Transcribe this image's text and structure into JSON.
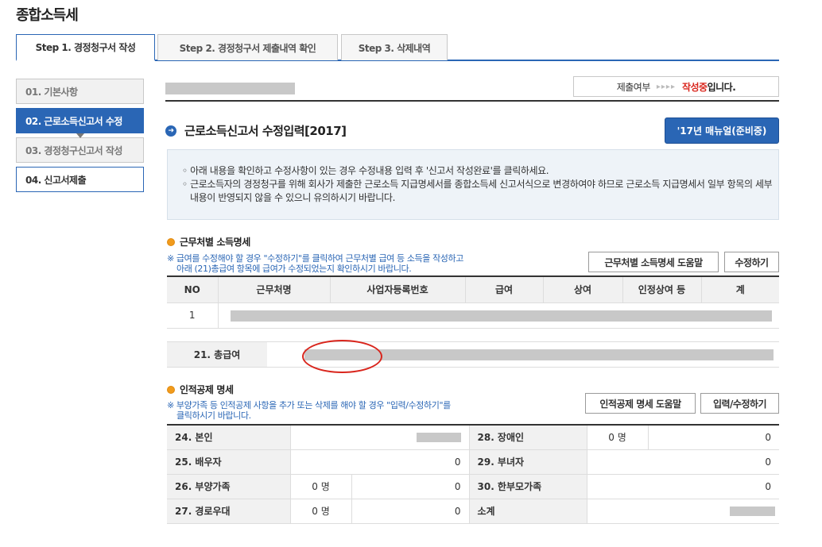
{
  "page": {
    "title": "종합소득세"
  },
  "tabs": [
    {
      "label": "Step 1. 경정청구서 작성",
      "active": true
    },
    {
      "label": "Step 2. 경정청구서 제출내역 확인",
      "active": false
    },
    {
      "label": "Step 3. 삭제내역",
      "active": false
    }
  ],
  "steps": [
    {
      "label": "01. 기본사항"
    },
    {
      "label": "02. 근로소득신고서 수정"
    },
    {
      "label": "03. 경정청구신고서 작성"
    },
    {
      "label": "04. 신고서제출"
    }
  ],
  "status": {
    "label": "제출여부",
    "arrow": "▸▸▸▸",
    "value_red": "작성중",
    "value_suffix": "입니다."
  },
  "section": {
    "icon": "arrow-right-circle-icon",
    "title": "근로소득신고서 수정입력[2017]",
    "manual_button": "'17년 매뉴얼(준비중)"
  },
  "notice": [
    "◦ 아래 내용을 확인하고 수정사항이 있는 경우 수정내용 입력 후 '신고서 작성완료'를 클릭하세요.",
    "◦ 근로소득자의 경정청구를 위해 회사가 제출한 근로소득 지급명세서를 종합소득세 신고서식으로 변경하여야 하므로 근로소득 지급명세서 일부 항목의 세부 내용이 반영되지 않을 수 있으니 유의하시기 바랍니다."
  ],
  "income": {
    "title": "근무처별 소득명세",
    "note_line1": "※ 급여를 수정해야 할 경우 \"수정하기\"를 클릭하여 근무처별 급여 등 소득을 작성하고",
    "note_line2": "아래 (21)총급여 항목에 급여가 수정되었는지 확인하시기 바랍니다.",
    "help_button": "근무처별 소득명세 도움말",
    "edit_button": "수정하기",
    "columns": [
      "NO",
      "근무처명",
      "사업자등록번호",
      "급여",
      "상여",
      "인정상여 등",
      "계"
    ],
    "rows": [
      {
        "no": "1"
      }
    ],
    "total_label": "21. 총급여"
  },
  "deduction": {
    "title": "인적공제 명세",
    "note_line1": "※ 부양가족 등 인적공제 사항을 추가 또는 삭제를 해야 할 경우 \"입력/수정하기\"를",
    "note_line2": "클릭하시기 바랍니다.",
    "help_button": "인적공제 명세 도움말",
    "edit_button": "입력/수정하기",
    "r1": {
      "left_label": "24. 본인",
      "right_label": "28. 장애인",
      "right_count": "0 명",
      "right_value": "0"
    },
    "r2": {
      "left_label": "25. 배우자",
      "left_value": "0",
      "right_label": "29. 부녀자",
      "right_value": "0"
    },
    "r3": {
      "left_label": "26. 부양가족",
      "left_count": "0 명",
      "left_value": "0",
      "right_label": "30. 한부모가족",
      "right_value": "0"
    },
    "r4": {
      "left_label": "27. 경로우대",
      "left_count": "0 명",
      "left_value": "0",
      "right_label": "소계"
    }
  }
}
